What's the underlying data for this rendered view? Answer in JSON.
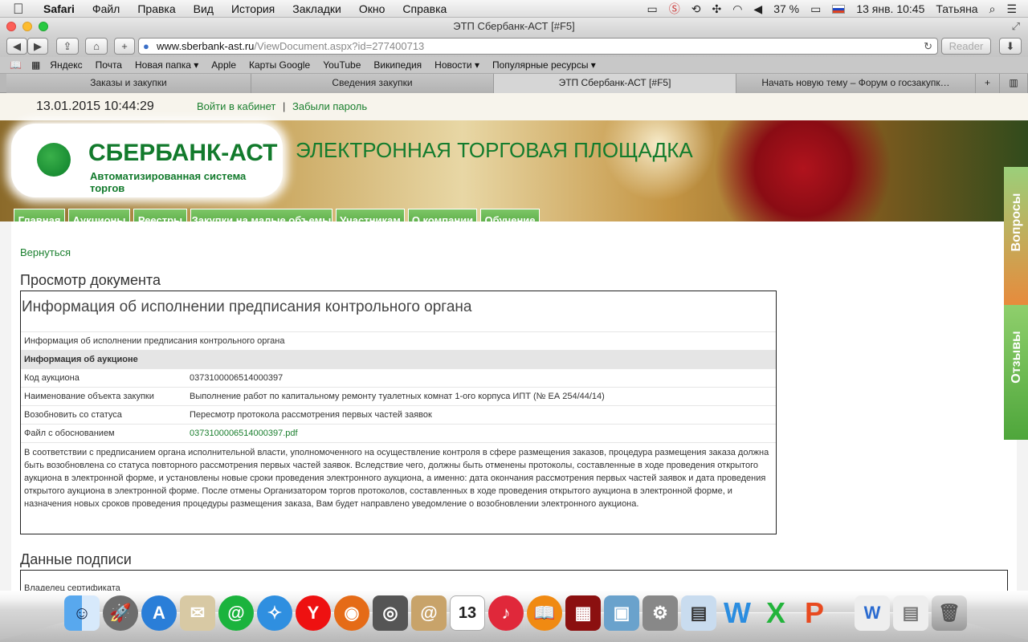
{
  "menubar": {
    "app": "Safari",
    "items": [
      "Файл",
      "Правка",
      "Вид",
      "История",
      "Закладки",
      "Окно",
      "Справка"
    ],
    "battery": "37 %",
    "clock": "13 янв.  10:45",
    "user": "Татьяна"
  },
  "window": {
    "title": "ЭТП Сбербанк-АСТ [#F5]"
  },
  "toolbar": {
    "url_host": "www.sberbank-ast.ru",
    "url_path": "/ViewDocument.aspx?id=277400713",
    "reader_label": "Reader"
  },
  "bookmarks": [
    "Яндекс",
    "Почта",
    "Новая папка ▾",
    "Apple",
    "Карты Google",
    "YouTube",
    "Википедия",
    "Новости ▾",
    "Популярные ресурсы ▾"
  ],
  "tabs": [
    {
      "label": "Заказы и закупки"
    },
    {
      "label": "Сведения закупки"
    },
    {
      "label": "ЭТП Сбербанк-АСТ [#F5]"
    },
    {
      "label": "Начать новую тему – Форум о госзакупк…"
    }
  ],
  "site": {
    "datetime": "13.01.2015   10:44:29",
    "login_link": "Войти в кабинет",
    "separator": "|",
    "forgot_link": "Забыли пароль",
    "logo_text": "СБЕРБАНК-АСТ",
    "logo_sub": "Автоматизированная система торгов",
    "banner_title": "ЭЛЕКТРОННАЯ ТОРГОВАЯ ПЛОЩАДКА",
    "nav": [
      "Главная",
      "Аукционы",
      "Реестры",
      "Закупки на малые объемы",
      "Участникам",
      "О компании",
      "Обучение"
    ],
    "side_questions": "Вопросы",
    "side_reviews": "Отзывы"
  },
  "content": {
    "back_link": "Вернуться",
    "heading": "Просмотр документа",
    "doc_title": "Информация об исполнении предписания контрольного органа",
    "doc_subtitle": "Информация об исполнении предписания контрольного органа",
    "section_header": "Информация об аукционе",
    "rows": [
      {
        "key": "Код аукциона",
        "value": "0373100006514000397"
      },
      {
        "key": "Наименование объекта закупки",
        "value": "Выполнение работ по капитальному ремонту туалетных комнат 1-ого корпуса ИПТ (№ ЕА 254/44/14)"
      },
      {
        "key": "Возобновить со статуса",
        "value": "Пересмотр протокола рассмотрения первых частей заявок"
      },
      {
        "key": "Файл с обоснованием",
        "value": "0373100006514000397.pdf"
      }
    ],
    "paragraph": "В соответствии с предписанием органа исполнительной власти, уполномоченного на осуществление контроля в сфере размещения заказов, процедура размещения заказа должна быть возобновлена со статуса повторного рассмотрения первых частей заявок. Вследствие чего, должны быть отменены протоколы, составленные в ходе проведения открытого аукциона в электронной форме, и установлены новые сроки проведения электронного аукциона, а именно: дата окончания рассмотрения первых частей заявок и дата проведения открытого аукциона в электронной форме. После отмены Организатором торгов протоколов, составленных в ходе проведения открытого аукциона в электронной форме, и назначения новых сроков проведения процедуры размещения заказа, Вам будет направлено уведомление о возобновлении электронного аукциона.",
    "signature_heading": "Данные подписи",
    "signature_row": "Владелец сертификата"
  },
  "dock": {
    "calendar_day": "13"
  }
}
